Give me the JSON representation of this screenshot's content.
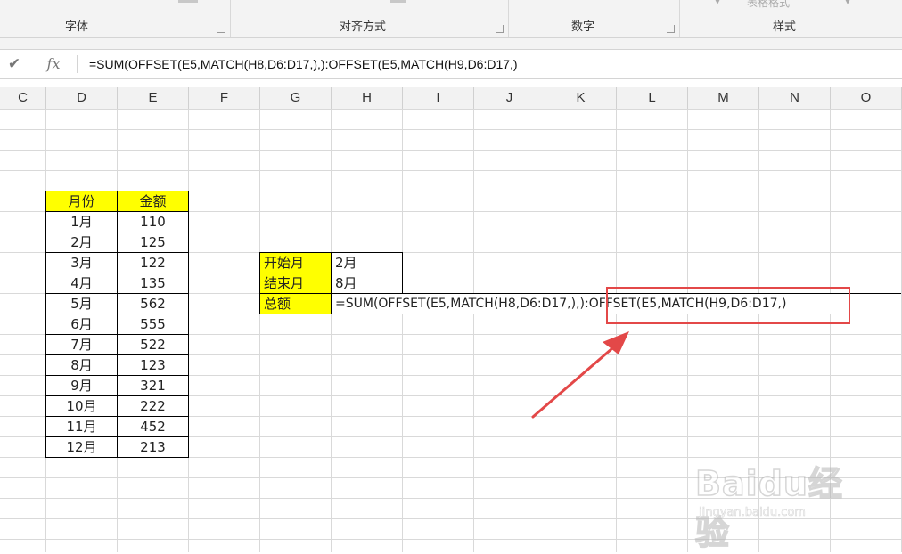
{
  "ribbon": {
    "groups": [
      {
        "label": "字体"
      },
      {
        "label": "对齐方式"
      },
      {
        "label": "数字"
      },
      {
        "label": "样式"
      }
    ],
    "style_cut_label": "表格格式"
  },
  "formula_bar": {
    "fx_label": "fx",
    "formula": "=SUM(OFFSET(E5,MATCH(H8,D6:D17,),):OFFSET(E5,MATCH(H9,D6:D17,)"
  },
  "columns": [
    "C",
    "D",
    "E",
    "F",
    "G",
    "H",
    "I",
    "J",
    "K",
    "L",
    "M",
    "N",
    "O"
  ],
  "table": {
    "headers": [
      "月份",
      "金额"
    ],
    "rows": [
      {
        "month": "1月",
        "amount": "110"
      },
      {
        "month": "2月",
        "amount": "125"
      },
      {
        "month": "3月",
        "amount": "122"
      },
      {
        "month": "4月",
        "amount": "135"
      },
      {
        "month": "5月",
        "amount": "562"
      },
      {
        "month": "6月",
        "amount": "555"
      },
      {
        "month": "7月",
        "amount": "522"
      },
      {
        "month": "8月",
        "amount": "123"
      },
      {
        "month": "9月",
        "amount": "321"
      },
      {
        "month": "10月",
        "amount": "222"
      },
      {
        "month": "11月",
        "amount": "452"
      },
      {
        "month": "12月",
        "amount": "213"
      }
    ]
  },
  "lookup": {
    "start_label": "开始月",
    "start_value": "2月",
    "end_label": "结束月",
    "end_value": "8月",
    "total_label": "总额",
    "total_formula_left": "=SUM(OFFSET(E5,MATCH(H8,D6:D17,),):",
    "total_formula_right": "OFFSET(E5,MATCH(H9,D6:D17,)"
  },
  "colors": {
    "highlight": "#ffff00",
    "annotation": "#e34848"
  },
  "watermark": {
    "logo": "Baidu经验",
    "url": "jingyan.baidu.com"
  }
}
